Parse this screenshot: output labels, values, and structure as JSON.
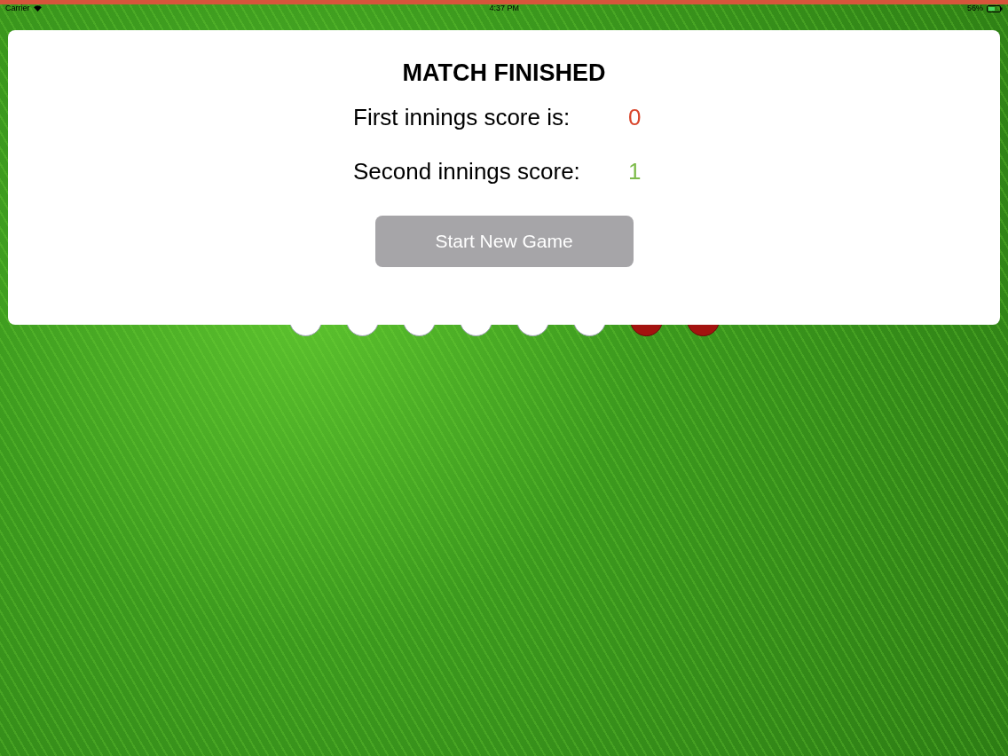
{
  "status_bar": {
    "carrier": "Carrier",
    "time": "4:37 PM",
    "battery": "56%"
  },
  "dialog": {
    "title": "MATCH FINISHED",
    "scores": [
      {
        "label": "First innings score is:",
        "value": "0",
        "color": "#d9452b"
      },
      {
        "label": "Second innings score:",
        "value": "1",
        "color": "#7dbb4a"
      }
    ],
    "button": "Start New Game"
  },
  "balls": [
    {
      "kind": "white"
    },
    {
      "kind": "white"
    },
    {
      "kind": "white"
    },
    {
      "kind": "white"
    },
    {
      "kind": "white"
    },
    {
      "kind": "white"
    },
    {
      "kind": "red"
    },
    {
      "kind": "red"
    }
  ]
}
